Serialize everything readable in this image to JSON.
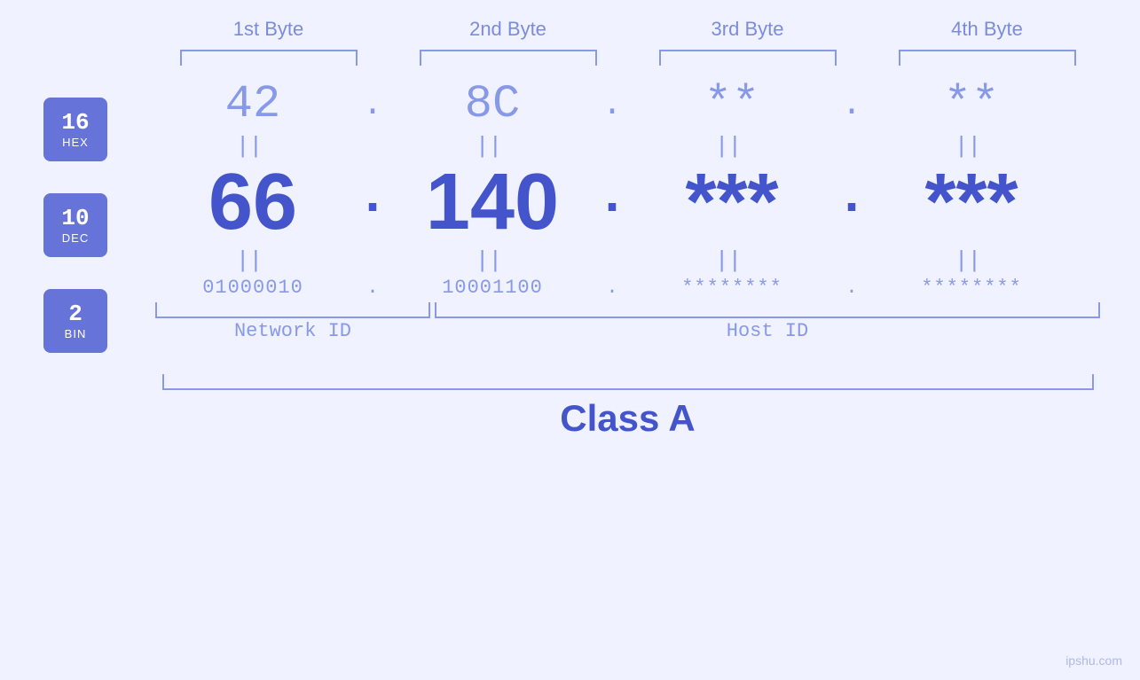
{
  "header": {
    "byte1": "1st Byte",
    "byte2": "2nd Byte",
    "byte3": "3rd Byte",
    "byte4": "4th Byte"
  },
  "badges": [
    {
      "id": "hex-badge",
      "num": "16",
      "label": "HEX"
    },
    {
      "id": "dec-badge",
      "num": "10",
      "label": "DEC"
    },
    {
      "id": "bin-badge",
      "num": "2",
      "label": "BIN"
    }
  ],
  "hex": {
    "b1": "42",
    "b2": "8C",
    "b3": "**",
    "b4": "**"
  },
  "dec": {
    "b1": "66",
    "b2": "140",
    "b3": "***",
    "b4": "***"
  },
  "bin": {
    "b1": "01000010",
    "b2": "10001100",
    "b3": "********",
    "b4": "********"
  },
  "labels": {
    "network_id": "Network ID",
    "host_id": "Host ID",
    "class": "Class A"
  },
  "footer": {
    "text": "ipshu.com"
  },
  "equals": "||",
  "dot": "."
}
